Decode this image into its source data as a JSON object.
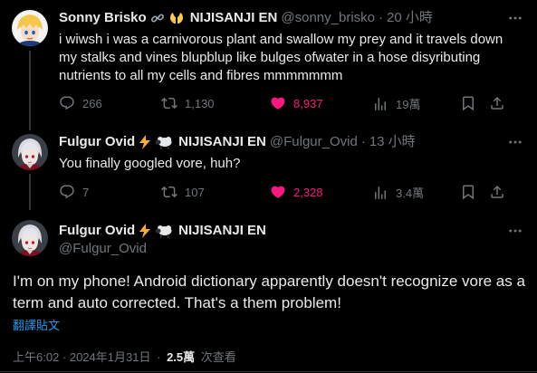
{
  "tweets": [
    {
      "author": "Sonny Brisko",
      "badge": "NIJISANJI EN",
      "handle": "@sonny_brisko",
      "separator": "·",
      "time": "20 小時",
      "text": "i wiwsh i was a carnivorous plant and swallow my prey and it travels down my stalks and vines blupblup like bulges ofwater in a hose disyributing nutrients to all my cells and fibres mmmmmmm",
      "replies": "266",
      "retweets": "1,130",
      "likes": "8,937",
      "views": "19萬",
      "liked": true,
      "emoji_icons": [
        "link-emoji",
        "hands-emoji"
      ]
    },
    {
      "author": "Fulgur Ovid",
      "badge": "NIJISANJI EN",
      "handle": "@Fulgur_Ovid",
      "separator": "·",
      "time": "13 小時",
      "text": "You finally googled vore, huh?",
      "replies": "7",
      "retweets": "107",
      "likes": "2,328",
      "views": "3.4萬",
      "liked": true,
      "emoji_icons": [
        "lightning-emoji",
        "sheep-emoji"
      ]
    }
  ],
  "main_tweet": {
    "author": "Fulgur Ovid",
    "badge": "NIJISANJI EN",
    "handle": "@Fulgur_Ovid",
    "text": "I'm on my phone! Android dictionary apparently doesn't recognize vore as a term and auto corrected. That's a them problem!",
    "translate_label": "翻譯貼文",
    "timestamp": "上午6:02 · 2024年1月31日",
    "separator": "·",
    "views": "2.5萬",
    "views_label": "次查看",
    "emoji_icons": [
      "lightning-emoji",
      "sheep-emoji"
    ]
  },
  "colors": {
    "background": "#000000",
    "text": "#e7e9ea",
    "secondary": "#71767b",
    "like_pink": "#f91880",
    "link_blue": "#1d9bf0",
    "divider": "#2f3336"
  },
  "icons": [
    "more-icon",
    "reply-icon",
    "retweet-icon",
    "like-icon",
    "views-icon",
    "bookmark-icon",
    "share-icon"
  ]
}
